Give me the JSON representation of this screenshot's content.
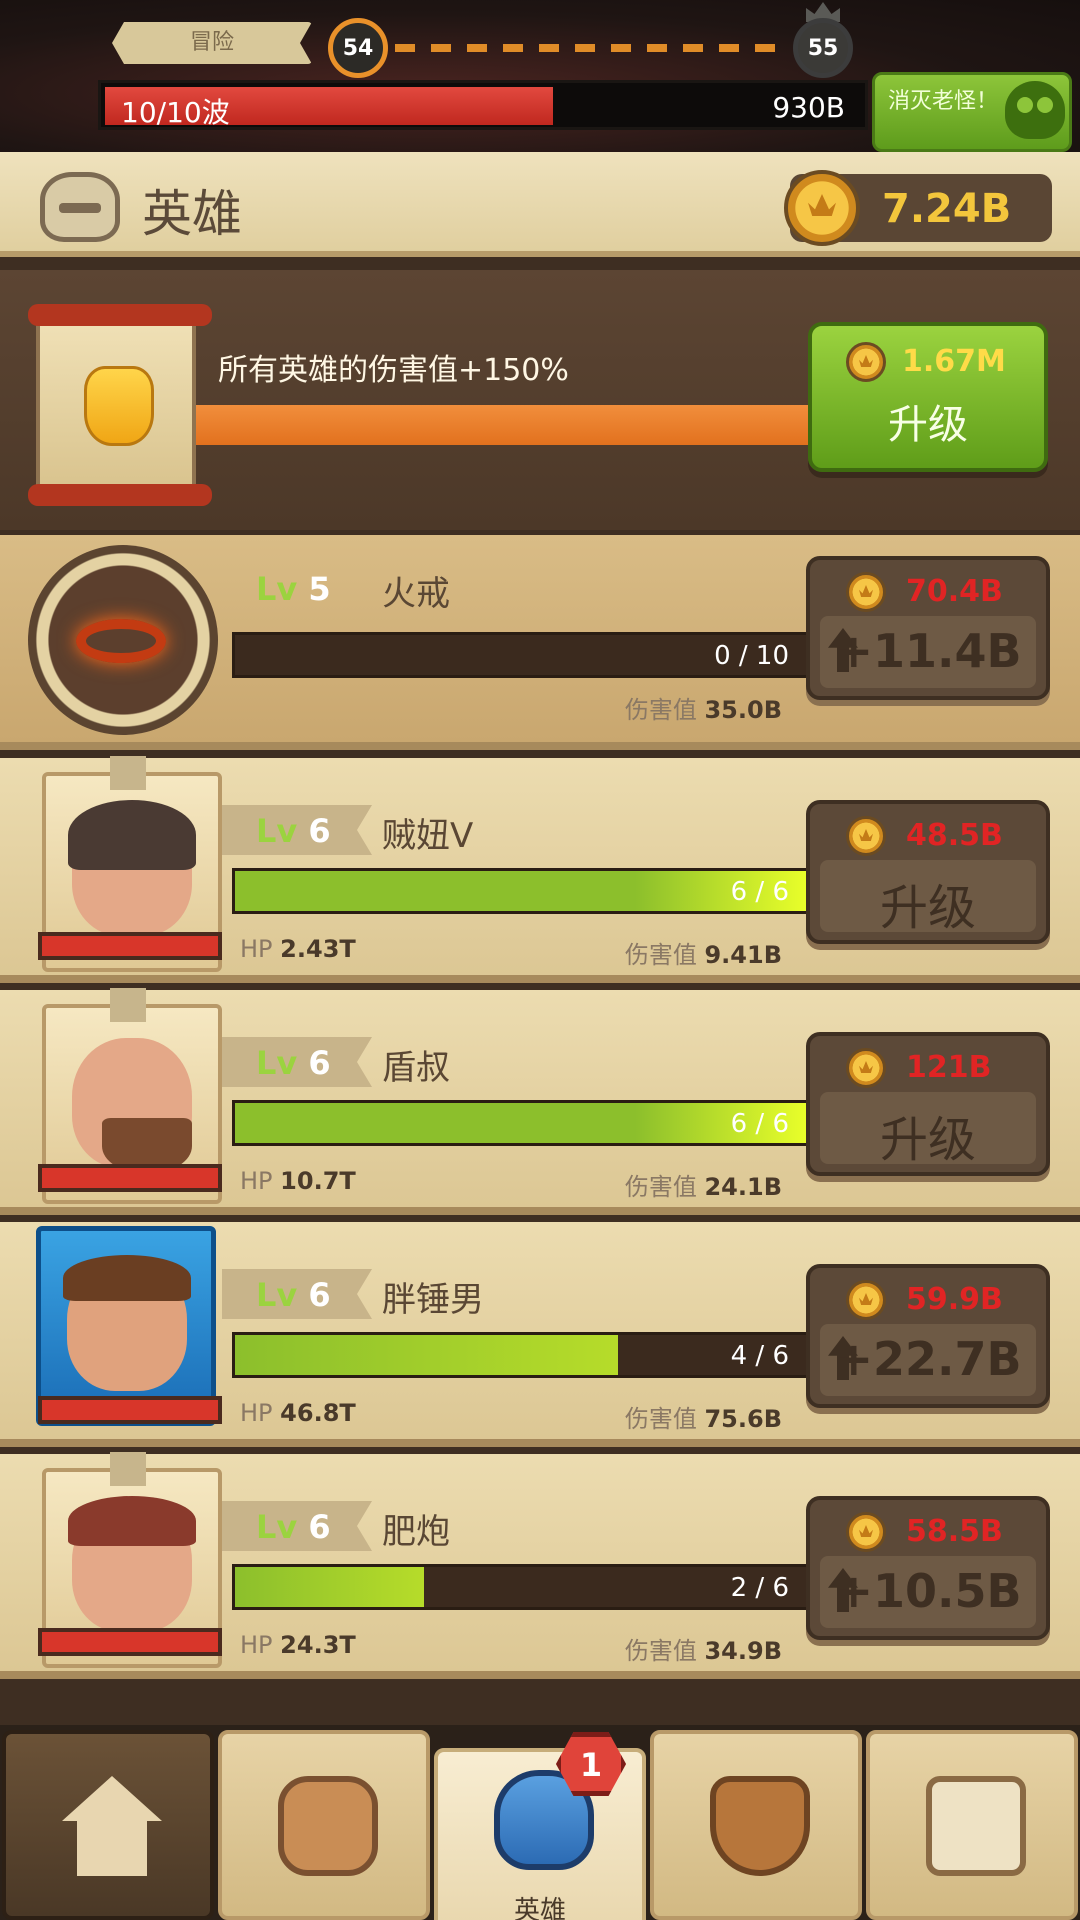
{
  "top": {
    "adventure_label": "冒险",
    "current_level": "54",
    "next_level": "55",
    "wave_text": "10/10波",
    "wave_progress": 0.59,
    "boss_hp": "930B",
    "boss_button": "消灭老怪！",
    "boss_icon": "skull-icon"
  },
  "header": {
    "title": "英雄",
    "icon": "helmet-icon",
    "gold": "7.24B"
  },
  "global_upgrade": {
    "description": "所有英雄的伤害值+150%",
    "icon": "fist-icon",
    "cost": "1.67M",
    "button_label": "升级"
  },
  "rows": [
    {
      "type": "item",
      "level_prefix": "Lv",
      "level": "5",
      "name": "火戒",
      "progress_text": "0 / 10",
      "progress": 0,
      "dmg_label": "伤害值",
      "dmg_value": "35.0B",
      "cost": "70.4B",
      "gain": "+11.4B"
    },
    {
      "type": "hero",
      "level_prefix": "Lv",
      "level": "6",
      "name": "贼妞V",
      "progress_text": "6 / 6",
      "progress": 1,
      "hp_label": "HP",
      "hp_value": "2.43T",
      "dmg_label": "伤害值",
      "dmg_value": "9.41B",
      "cost": "48.5B",
      "action": "升级"
    },
    {
      "type": "hero",
      "level_prefix": "Lv",
      "level": "6",
      "name": "盾叔",
      "progress_text": "6 / 6",
      "progress": 1,
      "hp_label": "HP",
      "hp_value": "10.7T",
      "dmg_label": "伤害值",
      "dmg_value": "24.1B",
      "cost": "121B",
      "action": "升级"
    },
    {
      "type": "hero",
      "level_prefix": "Lv",
      "level": "6",
      "name": "胖锤男",
      "progress_text": "4 / 6",
      "progress": 0.67,
      "hp_label": "HP",
      "hp_value": "46.8T",
      "dmg_label": "伤害值",
      "dmg_value": "75.6B",
      "cost": "59.9B",
      "gain": "+22.7B"
    },
    {
      "type": "hero",
      "level_prefix": "Lv",
      "level": "6",
      "name": "肥炮",
      "progress_text": "2 / 6",
      "progress": 0.33,
      "hp_label": "HP",
      "hp_value": "24.3T",
      "dmg_label": "伤害值",
      "dmg_value": "34.9B",
      "cost": "58.5B",
      "gain": "+10.5B"
    }
  ],
  "nav": {
    "tabs": [
      {
        "icon": "house-icon"
      },
      {
        "icon": "rune-icon"
      },
      {
        "icon": "hero-helmet-icon",
        "label": "英雄",
        "badge": "1"
      },
      {
        "icon": "cauldron-icon"
      },
      {
        "icon": "chest-icon"
      }
    ]
  },
  "colors": {
    "accent_green": "#8dc53a",
    "cost_red": "#e12424",
    "gold": "#f3c63c",
    "progress_orange": "#e08c28"
  }
}
